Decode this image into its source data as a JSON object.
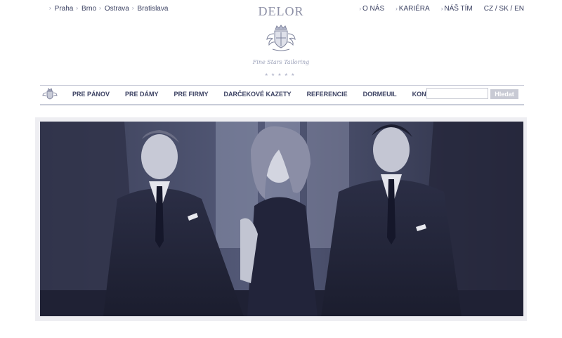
{
  "topbar": {
    "cities": [
      "Praha",
      "Brno",
      "Ostrava",
      "Bratislava"
    ],
    "links": [
      "O NÁS",
      "KARIÉRA",
      "NÁŠ TÍM"
    ],
    "languages": "CZ / SK / EN"
  },
  "brand": {
    "name": "DELOR",
    "tagline": "Fine Stars Tailoring",
    "stars": "★★★★★"
  },
  "nav": {
    "items": [
      "PRE PÁNOV",
      "PRE DÁMY",
      "PRE FIRMY",
      "DARČEKOVÉ KAZETY",
      "REFERENCIE",
      "DORMEUIL",
      "KONTAKTY"
    ],
    "search_placeholder": "",
    "search_button": "Hledat"
  },
  "colors": {
    "text": "#3b4162",
    "divider": "#c9ccd8",
    "button": "#c8cad4",
    "hero_tone": "#2c2f46"
  },
  "icons": {
    "bullet": "chevron-right-icon",
    "crest": "crest-logo",
    "nav_logo": "crest-small-icon"
  }
}
